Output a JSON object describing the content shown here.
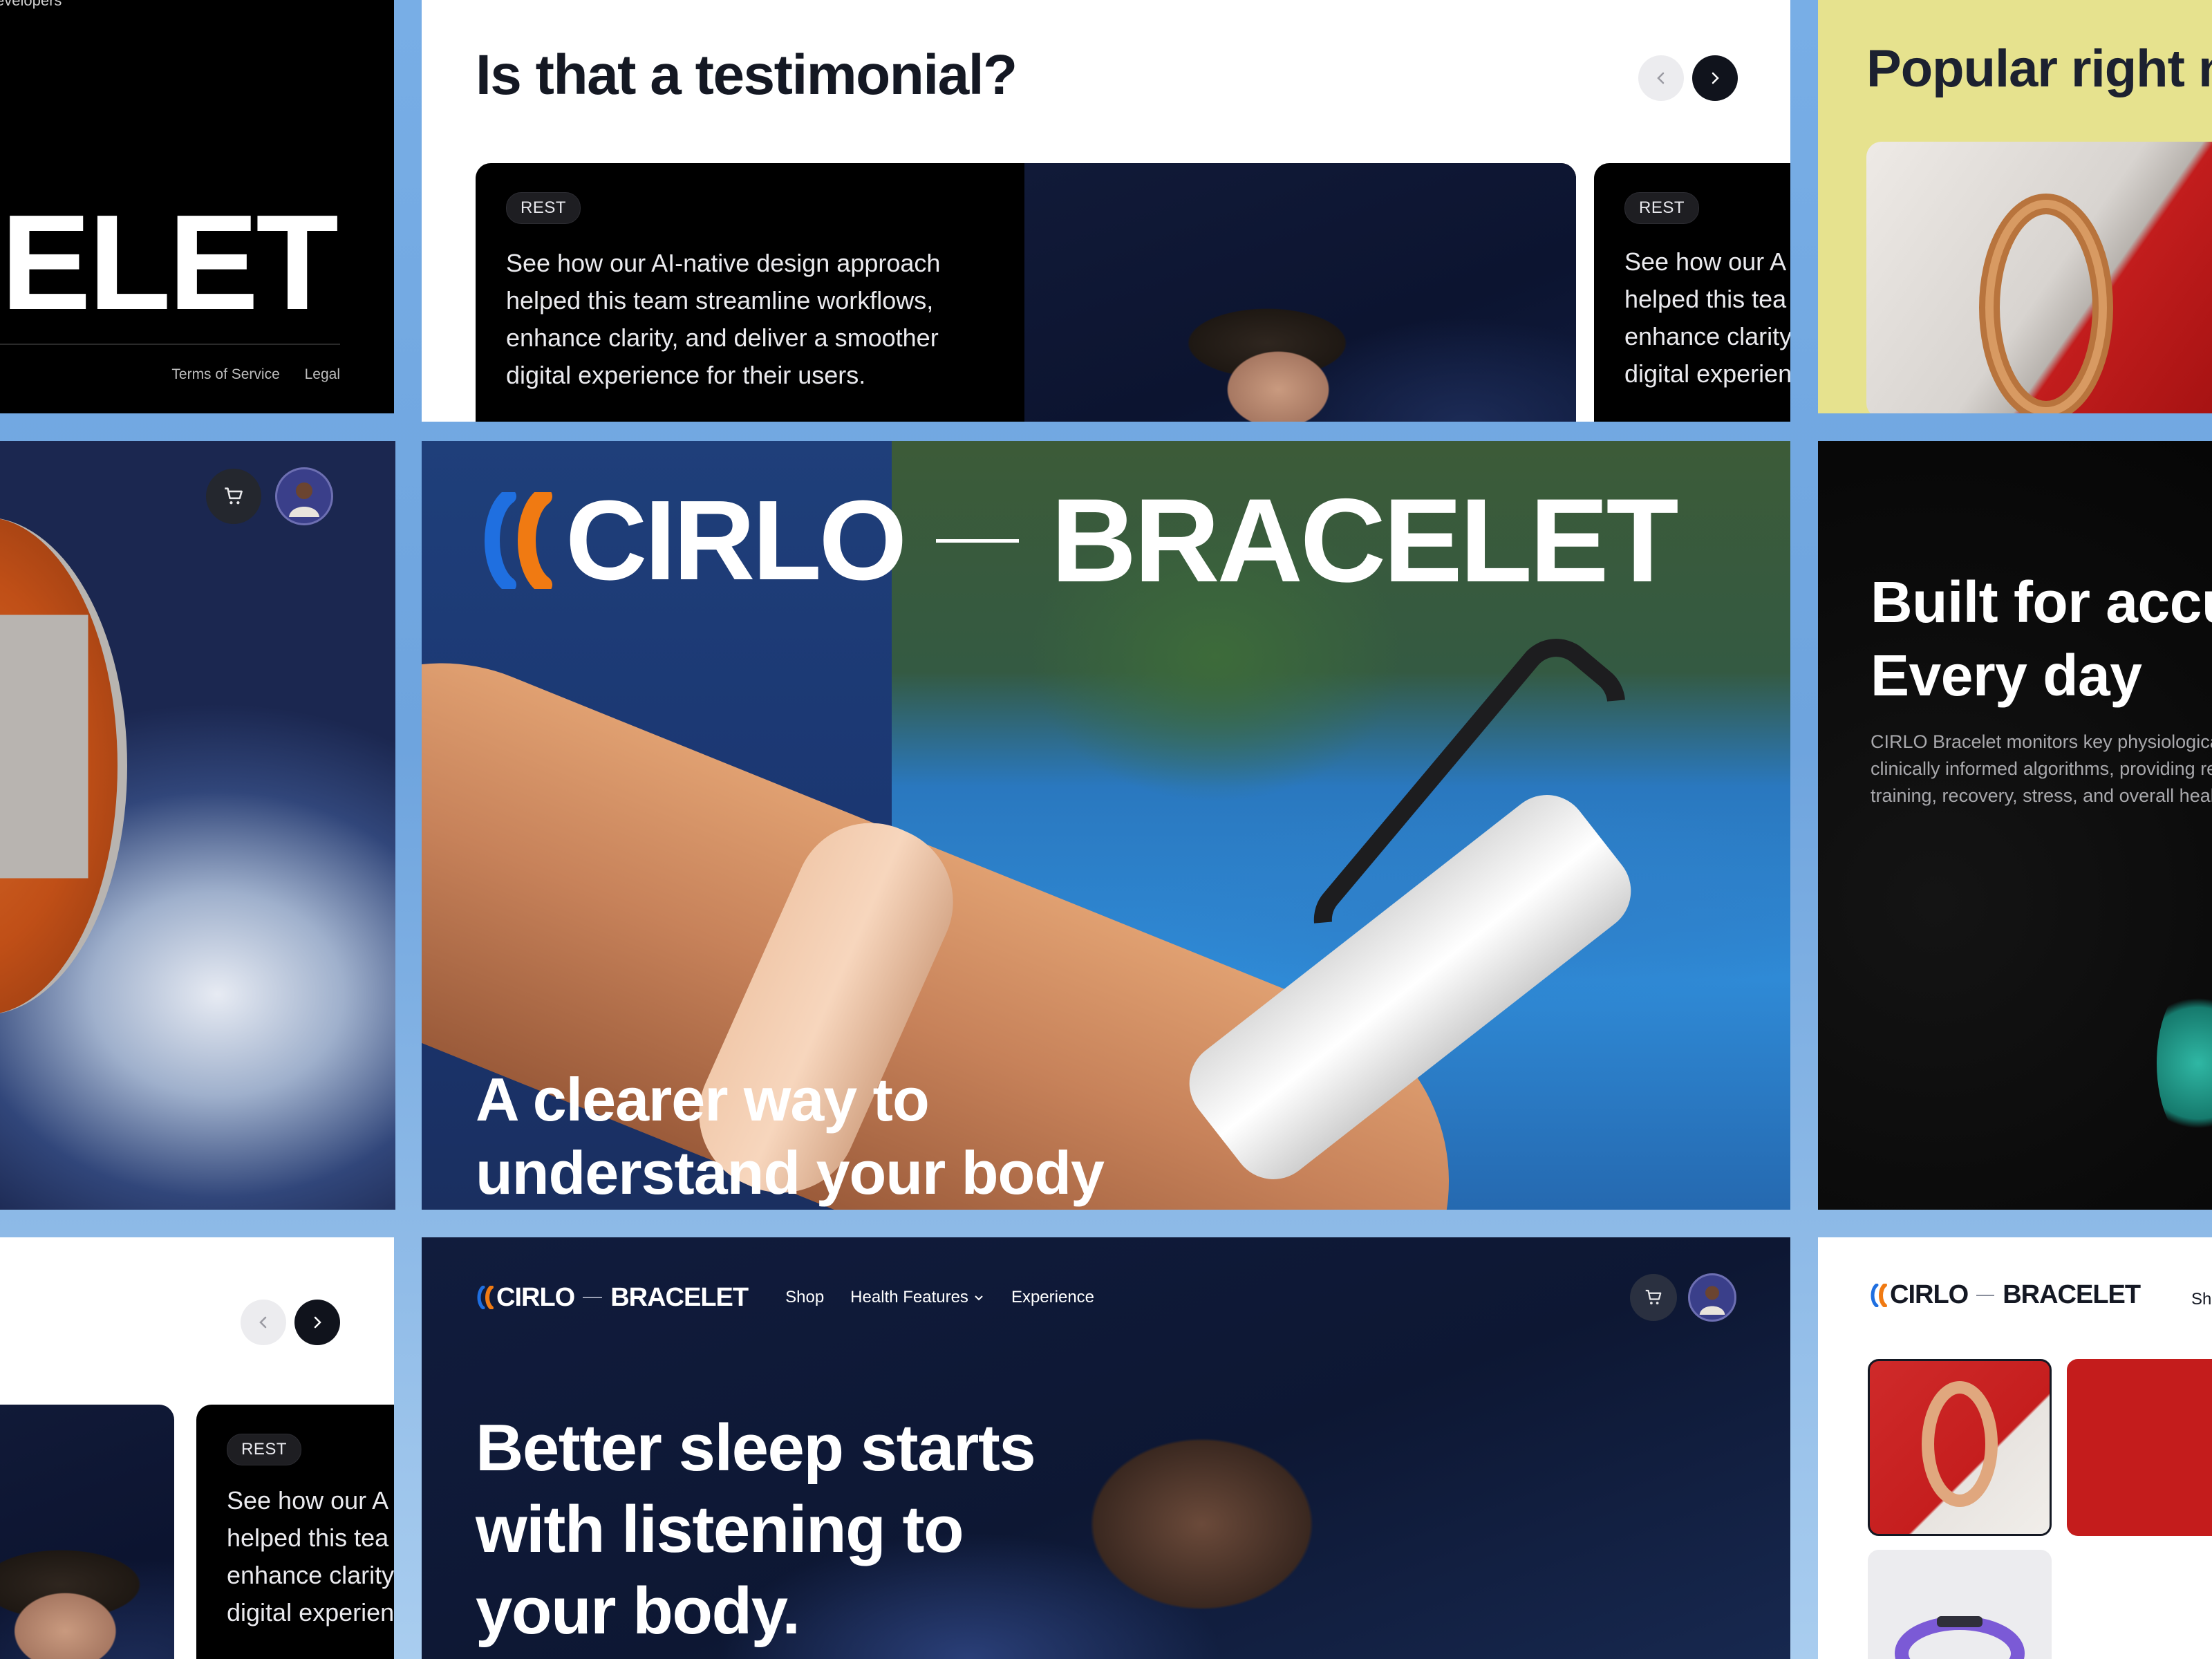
{
  "footer_panel": {
    "top_label": "evelopers",
    "big_text": "CELET",
    "links": [
      "Terms of Service",
      "Legal"
    ]
  },
  "testimonial_panel": {
    "heading": "Is that a testimonial?",
    "cards": [
      {
        "tag": "REST",
        "quote": [
          "See how our AI-native design approach",
          "helped this team streamline workflows,",
          "enhance clarity, and deliver a smoother",
          "digital experience for their users."
        ]
      },
      {
        "tag": "REST",
        "quote": [
          "See how our A",
          "helped this tea",
          "enhance clarity",
          "digital experien"
        ]
      }
    ],
    "nav": {
      "prev_icon": "chevron-left-icon",
      "next_icon": "chevron-right-icon"
    }
  },
  "popular_panel": {
    "title": "Popular right n"
  },
  "left_mid_panel": {
    "cart_icon": "cart-icon",
    "avatar_icon": "avatar"
  },
  "hero_panel": {
    "brand_name": "CIRLO",
    "brand_product": "BRACELET",
    "tagline": [
      "A clearer way to",
      "understand your body"
    ]
  },
  "right_mid_panel": {
    "heading": [
      "Built for accu",
      "Every day"
    ],
    "paragraph": [
      "CIRLO Bracelet monitors key physiological",
      "clinically informed algorithms, providing re",
      "training, recovery, stress, and overall health"
    ]
  },
  "bottom_left_panel": {
    "card": {
      "tag": "REST",
      "quote": [
        "See how our A",
        "helped this tea",
        "enhance clarity",
        "digital experien"
      ]
    }
  },
  "sleep_panel": {
    "brand_name": "CIRLO",
    "brand_product": "BRACELET",
    "nav": [
      "Shop",
      "Health Features",
      "Experience"
    ],
    "headline": [
      "Better sleep starts",
      "with listening to",
      "your body."
    ]
  },
  "bottom_right_panel": {
    "brand_name": "CIRLO",
    "brand_product": "BRACELET",
    "nav_partial": "Sh"
  },
  "colors": {
    "background_blue": "#6ea4de",
    "logo_blue": "#1f6fe0",
    "logo_orange": "#f07a12",
    "popular_yellow": "#e6e28e",
    "dark_navy": "#0d1733"
  }
}
